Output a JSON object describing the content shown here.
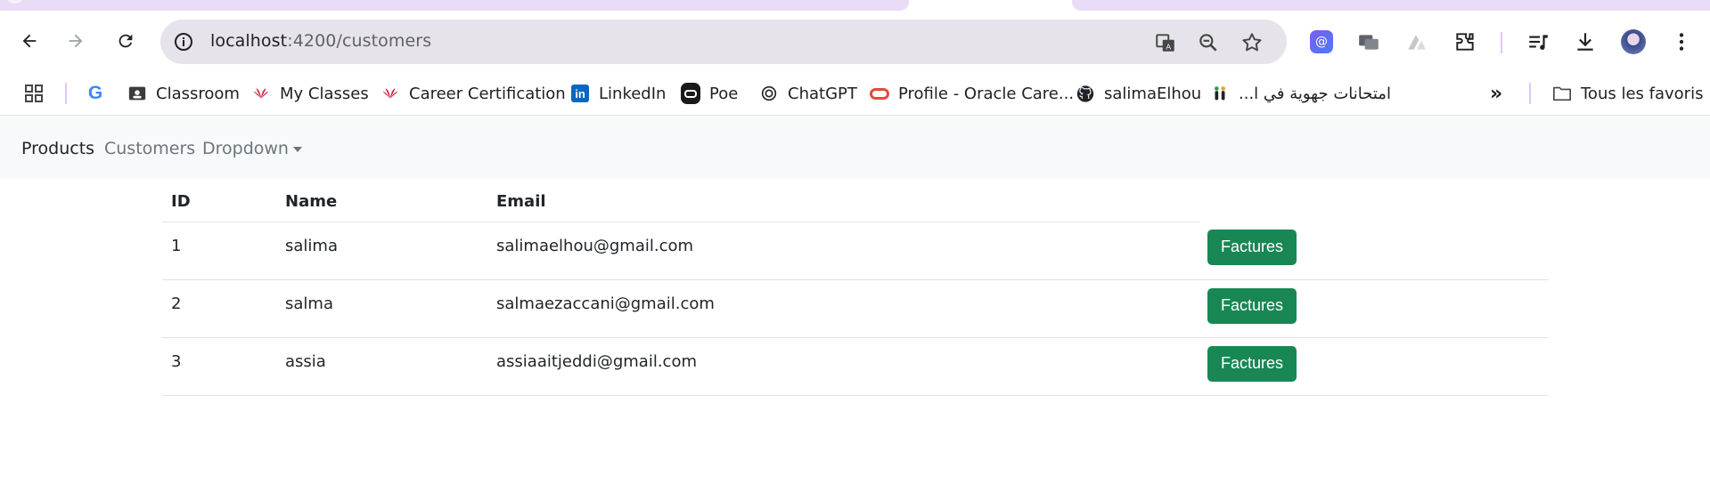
{
  "browser": {
    "url_host": "localhost",
    "url_path": ":4200/customers",
    "bookmarks": [
      {
        "label": "Classroom",
        "icon": "classroom-icon"
      },
      {
        "label": "My Classes",
        "icon": "huawei-icon"
      },
      {
        "label": "Career Certification",
        "icon": "huawei-icon"
      },
      {
        "label": "LinkedIn",
        "icon": "linkedin-icon"
      },
      {
        "label": "Poe",
        "icon": "poe-icon"
      },
      {
        "label": "ChatGPT",
        "icon": "chatgpt-icon"
      },
      {
        "label": "Profile - Oracle Care...",
        "icon": "oracle-icon"
      },
      {
        "label": "salimaElhou",
        "icon": "github-icon"
      },
      {
        "label": "امتحانات جهوية في ا...",
        "icon": "people-icon"
      }
    ],
    "all_bookmarks_label": "Tous les favoris",
    "colors": {
      "tab_accent": "#e9dcf7",
      "omnibox": "#e7e3ea"
    }
  },
  "navbar": {
    "items": [
      {
        "label": "Products",
        "active": true
      },
      {
        "label": "Customers",
        "active": false
      },
      {
        "label": "Dropdown",
        "active": false
      }
    ]
  },
  "table": {
    "headers": [
      "ID",
      "Name",
      "Email",
      ""
    ],
    "rows": [
      {
        "id": "1",
        "name": "salima",
        "email": "salimaelhou@gmail.com",
        "action": "Factures"
      },
      {
        "id": "2",
        "name": "salma",
        "email": "salmaezaccani@gmail.com",
        "action": "Factures"
      },
      {
        "id": "3",
        "name": "assia",
        "email": "assiaaitjeddi@gmail.com",
        "action": "Factures"
      }
    ],
    "colors": {
      "button": "#198754"
    }
  }
}
